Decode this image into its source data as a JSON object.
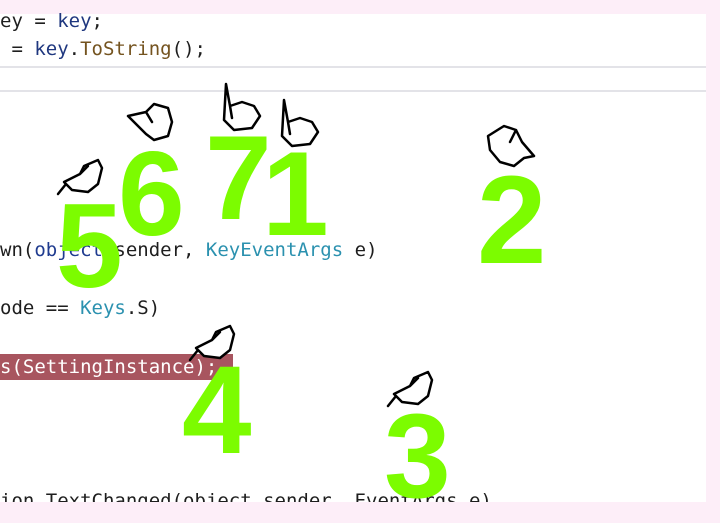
{
  "code": {
    "line1": {
      "a": "ey = ",
      "b": "key",
      "c": ";"
    },
    "line2": {
      "a": " = ",
      "b": "key",
      "c": ".",
      "d": "ToString",
      "e": "();"
    },
    "line3": {
      "a": "wn(",
      "b": "object",
      "c": " sender, ",
      "d": "KeyEventArgs",
      "e": " e)"
    },
    "line4": {
      "a": "ode == ",
      "b": "Keys",
      "c": ".S)"
    },
    "line5": "s(SettingInstance);",
    "line6": "ion_TextChanged(object sender, EventArgs e)"
  },
  "markers": [
    "1",
    "2",
    "3",
    "4",
    "5",
    "6",
    "7"
  ],
  "colors": {
    "marker": "#7cfc00",
    "highlight": "#a8555f",
    "type": "#2b91af"
  },
  "icons": [
    "pointing-hand-icon"
  ]
}
